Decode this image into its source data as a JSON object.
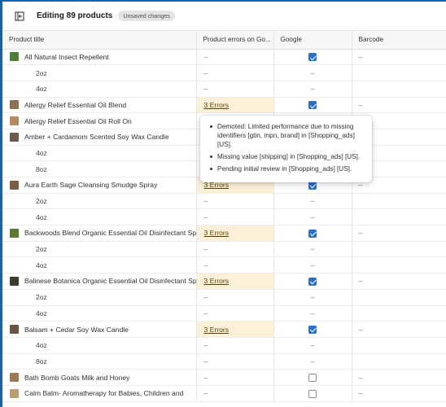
{
  "header": {
    "title": "Editing 89 products",
    "badge": "Unsaved changes"
  },
  "columns": [
    "Product title",
    "Product errors on Go...",
    "Google",
    "Barcode"
  ],
  "rows": [
    {
      "kind": "product",
      "title": "All Natural Insect Repellent",
      "thumb": "#4f7d3a",
      "errors": "–",
      "google": true,
      "barcode": "–"
    },
    {
      "kind": "variant",
      "title": "2oz",
      "errors": "–",
      "google": "–",
      "barcode": ""
    },
    {
      "kind": "variant",
      "title": "4oz",
      "errors": "–",
      "google": "–",
      "barcode": ""
    },
    {
      "kind": "product",
      "title": "Allergy Relief Essential Oil Blend",
      "thumb": "#8a7250",
      "errors": "3 Errors",
      "google": true,
      "barcode": "–"
    },
    {
      "kind": "product",
      "title": "Allergy Relief Essential Oil Roll On",
      "thumb": "#b58a60",
      "errors": "",
      "google": "",
      "barcode": ""
    },
    {
      "kind": "product",
      "title": "Amber + Cardamom Scented Soy Wax Candle",
      "thumb": "#6d5a4a",
      "errors": "",
      "google": "",
      "barcode": ""
    },
    {
      "kind": "variant",
      "title": "4oz",
      "errors": "",
      "google": "",
      "barcode": ""
    },
    {
      "kind": "variant",
      "title": "8oz",
      "errors": "",
      "google": "",
      "barcode": ""
    },
    {
      "kind": "product",
      "title": "Aura Earth Sage Cleansing Smudge Spray",
      "thumb": "#7a5e44",
      "errors": "3 Errors",
      "google": true,
      "barcode": "–"
    },
    {
      "kind": "variant",
      "title": "2oz",
      "errors": "–",
      "google": "–",
      "barcode": ""
    },
    {
      "kind": "variant",
      "title": "4oz",
      "errors": "–",
      "google": "–",
      "barcode": ""
    },
    {
      "kind": "product",
      "title": "Backwoods Blend Organic Essential Oil Disinfectant Sp",
      "thumb": "#5d7a33",
      "errors": "3 Errors",
      "google": true,
      "barcode": "–"
    },
    {
      "kind": "variant",
      "title": "2oz",
      "errors": "–",
      "google": "–",
      "barcode": ""
    },
    {
      "kind": "variant",
      "title": "4oz",
      "errors": "–",
      "google": "–",
      "barcode": ""
    },
    {
      "kind": "product",
      "title": "Balinese Botanica Organic Essential Oil Disinfectant Sp",
      "thumb": "#3e3a2c",
      "errors": "3 Errors",
      "google": true,
      "barcode": "–"
    },
    {
      "kind": "variant",
      "title": "2oz",
      "errors": "–",
      "google": "–",
      "barcode": ""
    },
    {
      "kind": "variant",
      "title": "4oz",
      "errors": "–",
      "google": "–",
      "barcode": ""
    },
    {
      "kind": "product",
      "title": "Balsam + Cedar Soy Wax Candle",
      "thumb": "#6a5444",
      "errors": "3 Errors",
      "google": true,
      "barcode": "–"
    },
    {
      "kind": "variant",
      "title": "4oz",
      "errors": "–",
      "google": "–",
      "barcode": ""
    },
    {
      "kind": "variant",
      "title": "8oz",
      "errors": "–",
      "google": "–",
      "barcode": ""
    },
    {
      "kind": "product",
      "title": "Bath Bomb Goats Milk and Honey",
      "thumb": "#9c7a55",
      "errors": "–",
      "google": false,
      "barcode": "–"
    },
    {
      "kind": "product",
      "title": "Calm Balm- Aromatherapy for Babies, Children and",
      "thumb": "#b8a070",
      "errors": "–",
      "google": false,
      "barcode": "–"
    }
  ],
  "tooltip": {
    "items": [
      "Demoted: Limited performance due to missing identifiers [gtin, mpn, brand] in [Shopping_ads] [US].",
      "Missing value [shipping] in [Shopping_ads] [US].",
      "Pending initial review in [Shopping_ads] [US]."
    ]
  },
  "icons": {
    "exit": "exit-icon",
    "checkbox": "checkbox-icon"
  },
  "colors": {
    "accent": "#2c6ecb",
    "error_bg": "#fcf1d8",
    "window_border": "#1f5fa6"
  }
}
